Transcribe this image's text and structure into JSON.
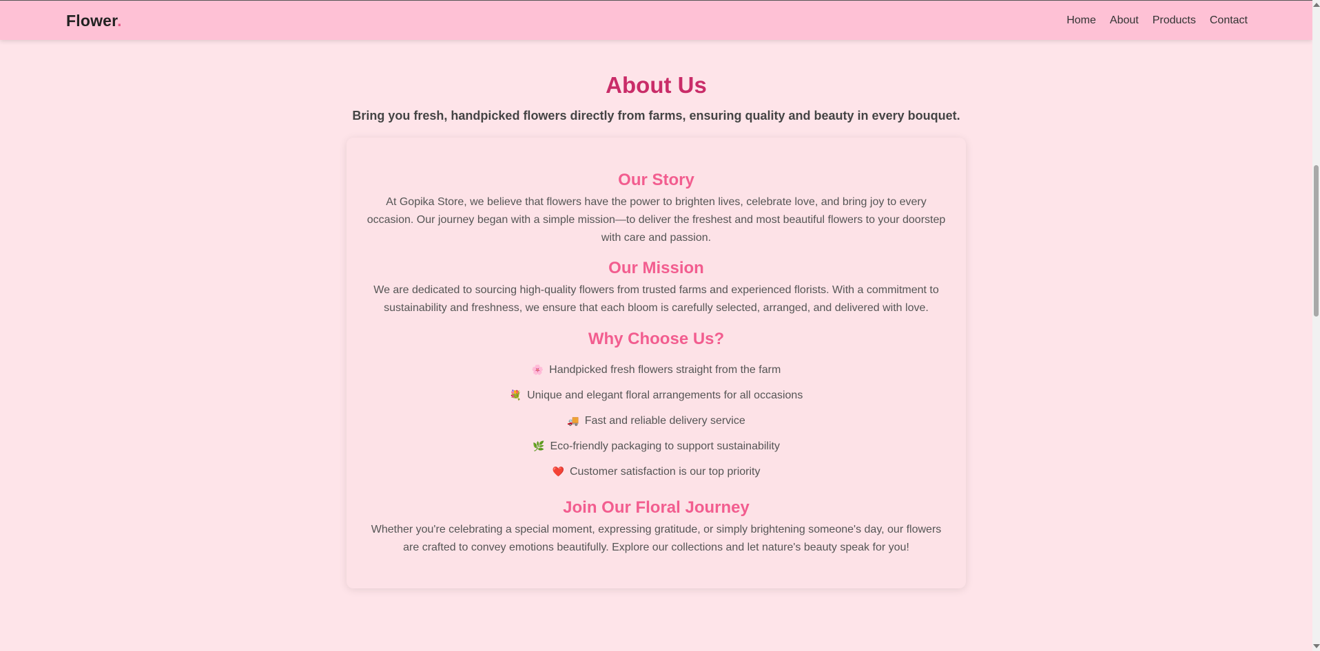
{
  "navbar": {
    "brand": "Flower",
    "brand_dot": ".",
    "links": [
      "Home",
      "About",
      "Products",
      "Contact"
    ]
  },
  "hero": {
    "title": "About Us",
    "tagline": "Bring you fresh, handpicked flowers directly from farms, ensuring quality and beauty in every bouquet."
  },
  "story": {
    "heading": "Our Story",
    "text": "At Gopika Store, we believe that flowers have the power to brighten lives, celebrate love, and bring joy to every occasion. Our journey began with a simple mission—to deliver the freshest and most beautiful flowers to your doorstep with care and passion."
  },
  "mission": {
    "heading": "Our Mission",
    "text": "We are dedicated to sourcing high-quality flowers from trusted farms and experienced florists. With a commitment to sustainability and freshness, we ensure that each bloom is carefully selected, arranged, and delivered with love."
  },
  "why": {
    "heading": "Why Choose Us?",
    "items": [
      {
        "icon": "🌸",
        "text": "Handpicked fresh flowers straight from the farm"
      },
      {
        "icon": "💐",
        "text": "Unique and elegant floral arrangements for all occasions"
      },
      {
        "icon": "🚚",
        "text": "Fast and reliable delivery service"
      },
      {
        "icon": "🌿",
        "text": "Eco-friendly packaging to support sustainability"
      },
      {
        "icon": "❤️",
        "text": "Customer satisfaction is our top priority"
      }
    ]
  },
  "journey": {
    "heading": "Join Our Floral Journey",
    "text": "Whether you're celebrating a special moment, expressing gratitude, or simply brightening someone's day, our flowers are crafted to convey emotions beautifully. Explore our collections and let nature's beauty speak for you!"
  },
  "colors": {
    "page_bg": "#fee4e9",
    "nav_bg": "#fec1d5",
    "title": "#c92c68",
    "section_heading": "#f25d8f",
    "brand_dot": "#e85a8a"
  }
}
